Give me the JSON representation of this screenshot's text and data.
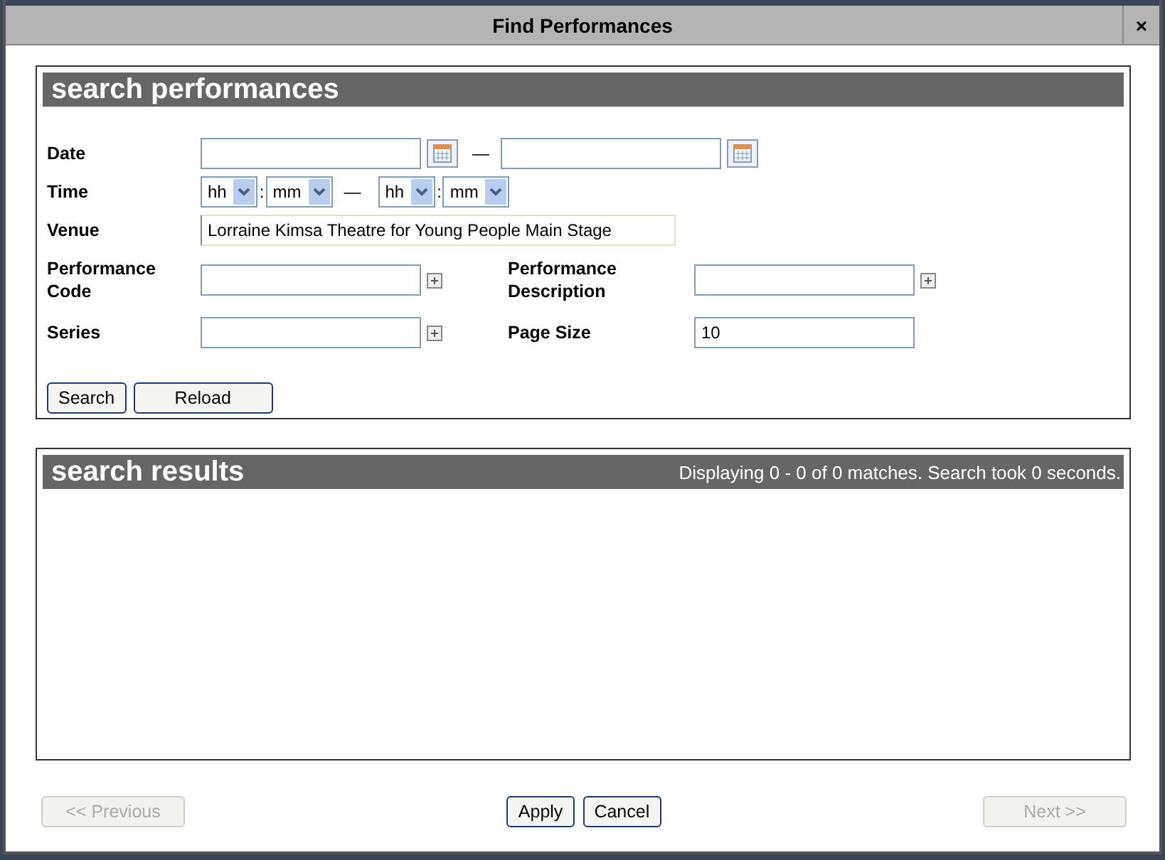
{
  "window": {
    "title": "Find Performances",
    "close": "×"
  },
  "search_panel": {
    "title": "search performances",
    "date": {
      "label": "Date",
      "separator": "—"
    },
    "time": {
      "label": "Time",
      "separator": "—",
      "from": {
        "hour": "hh",
        "colon": ":",
        "minute": "mm"
      },
      "to": {
        "hour": "hh",
        "colon": ":",
        "minute": "mm"
      }
    },
    "venue": {
      "label": "Venue",
      "value": "Lorraine Kimsa Theatre for Young People Main Stage"
    },
    "performance_code": {
      "label": "Performance Code"
    },
    "performance_description": {
      "label": "Performance Description"
    },
    "series": {
      "label": "Series"
    },
    "page_size": {
      "label": "Page Size",
      "value": "10"
    },
    "buttons": [
      "Search",
      "Reload"
    ]
  },
  "results_panel": {
    "title": "search results",
    "summary": "Displaying 0 - 0 of 0 matches. Search took 0 seconds."
  },
  "footer": [
    {
      "label": "<< Previous",
      "disabled": true,
      "kind": "left"
    },
    {
      "label": "Apply",
      "disabled": false,
      "kind": "center"
    },
    {
      "label": "Cancel",
      "disabled": false,
      "kind": "center"
    },
    {
      "label": "Next >>",
      "disabled": true,
      "kind": "right"
    }
  ]
}
